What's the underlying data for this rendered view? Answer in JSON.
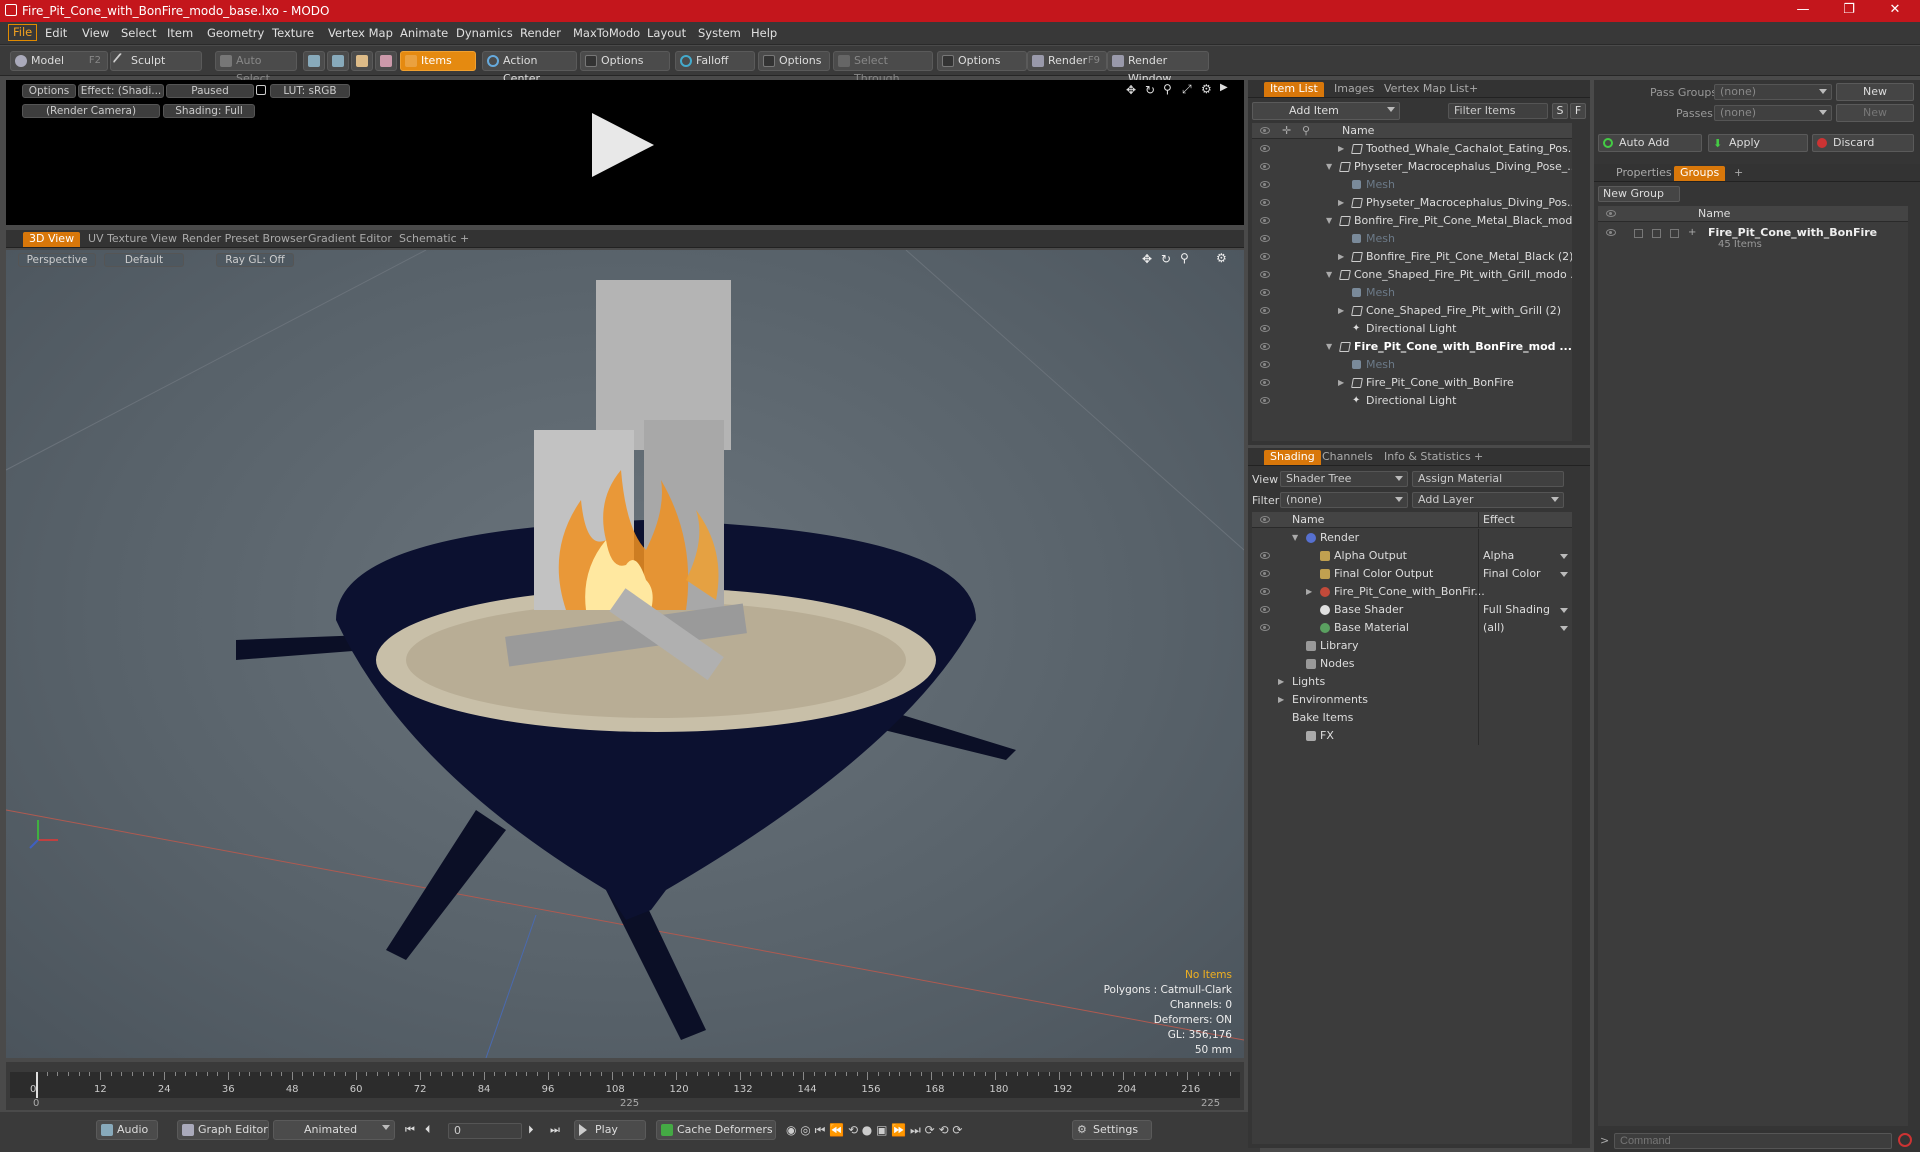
{
  "window": {
    "title": "Fire_Pit_Cone_with_BonFire_modo_base.lxo - MODO",
    "minimize": "—",
    "maximize": "❐",
    "close": "✕"
  },
  "menu": [
    "File",
    "Edit",
    "View",
    "Select",
    "Item",
    "Geometry",
    "Texture",
    "Vertex Map",
    "Animate",
    "Dynamics",
    "Render",
    "MaxToModo",
    "Layout",
    "System",
    "Help"
  ],
  "toolbar": {
    "model": "Model",
    "model_key": "F2",
    "sculpt": "Sculpt",
    "auto_select": "Auto Select",
    "items": "Items",
    "action_center": "Action Center",
    "options1": "Options",
    "falloff": "Falloff",
    "options2": "Options",
    "select_through": "Select Through",
    "options3": "Options",
    "render": "Render",
    "render_key": "F9",
    "render_window": "Render Window"
  },
  "preview": {
    "options": "Options",
    "effect": "Effect: (Shadi...",
    "paused": "Paused",
    "lut": "LUT: sRGB",
    "camera": "(Render Camera)",
    "shading": "Shading: Full"
  },
  "viewport_tabs": [
    "3D View",
    "UV Texture View",
    "Render Preset Browser",
    "Gradient Editor",
    "Schematic",
    "+"
  ],
  "viewport": {
    "perspective": "Perspective",
    "default": "Default",
    "raygl": "Ray GL: Off",
    "info": [
      "No Items",
      "Polygons : Catmull-Clark",
      "Channels: 0",
      "Deformers: ON",
      "GL: 356,176",
      "50 mm"
    ]
  },
  "timeline": {
    "ticks": [
      "0",
      "12",
      "24",
      "36",
      "48",
      "60",
      "72",
      "84",
      "96",
      "108",
      "120",
      "132",
      "144",
      "156",
      "168",
      "180",
      "192",
      "204",
      "216"
    ],
    "range_start": "0",
    "range_mid": "225",
    "range_end": "225"
  },
  "bottombar": {
    "audio": "Audio",
    "graph_editor": "Graph Editor",
    "animated": "Animated",
    "frame": "0",
    "play": "Play",
    "cache_deformers": "Cache Deformers",
    "settings": "Settings"
  },
  "item_list": {
    "tabs": [
      "Item List",
      "Images",
      "Vertex Map List",
      "+"
    ],
    "add_item": "Add Item",
    "filter_items": "Filter Items",
    "s": "S",
    "f": "F",
    "header_name": "Name",
    "rows": [
      {
        "label": "Toothed_Whale_Cachalot_Eating_Pos...",
        "type": "item",
        "indent": 3,
        "bold": false,
        "arrow": true,
        "dim": false
      },
      {
        "label": "Physeter_Macrocephalus_Diving_Pose_...",
        "type": "scene",
        "indent": 2,
        "bold": false,
        "arrow": true,
        "dim": false
      },
      {
        "label": "Mesh",
        "type": "mesh",
        "indent": 3,
        "bold": false,
        "arrow": false,
        "dim": true
      },
      {
        "label": "Physeter_Macrocephalus_Diving_Pos...",
        "type": "item",
        "indent": 3,
        "bold": false,
        "arrow": true,
        "dim": false
      },
      {
        "label": "Bonfire_Fire_Pit_Cone_Metal_Black_mod...",
        "type": "scene",
        "indent": 2,
        "bold": false,
        "arrow": true,
        "dim": false
      },
      {
        "label": "Mesh",
        "type": "mesh",
        "indent": 3,
        "bold": false,
        "arrow": false,
        "dim": true
      },
      {
        "label": "Bonfire_Fire_Pit_Cone_Metal_Black (2)",
        "type": "item",
        "indent": 3,
        "bold": false,
        "arrow": true,
        "dim": false
      },
      {
        "label": "Cone_Shaped_Fire_Pit_with_Grill_modo ...",
        "type": "scene",
        "indent": 2,
        "bold": false,
        "arrow": true,
        "dim": false
      },
      {
        "label": "Mesh",
        "type": "mesh",
        "indent": 3,
        "bold": false,
        "arrow": false,
        "dim": true
      },
      {
        "label": "Cone_Shaped_Fire_Pit_with_Grill (2)",
        "type": "item",
        "indent": 3,
        "bold": false,
        "arrow": true,
        "dim": false
      },
      {
        "label": "Directional Light",
        "type": "light",
        "indent": 3,
        "bold": false,
        "arrow": false,
        "dim": false
      },
      {
        "label": "Fire_Pit_Cone_with_BonFire_mod ...",
        "type": "scene",
        "indent": 2,
        "bold": true,
        "arrow": true,
        "dim": false
      },
      {
        "label": "Mesh",
        "type": "mesh",
        "indent": 3,
        "bold": false,
        "arrow": false,
        "dim": true
      },
      {
        "label": "Fire_Pit_Cone_with_BonFire",
        "type": "item",
        "indent": 3,
        "bold": false,
        "arrow": true,
        "dim": false
      },
      {
        "label": "Directional Light",
        "type": "light",
        "indent": 3,
        "bold": false,
        "arrow": false,
        "dim": false
      }
    ]
  },
  "shading": {
    "tabs": [
      "Shading",
      "Channels",
      "Info & Statistics",
      "+"
    ],
    "view_label": "View",
    "view_value": "Shader Tree",
    "assign_material": "Assign Material",
    "filter_label": "Filter",
    "filter_value": "(none)",
    "add_layer": "Add Layer",
    "header_name": "Name",
    "header_effect": "Effect",
    "rows": [
      {
        "label": "Render",
        "effect": "",
        "indent": 1,
        "eye": false,
        "icon": "sphere-blue"
      },
      {
        "label": "Alpha Output",
        "effect": "Alpha",
        "indent": 2,
        "eye": true,
        "icon": "output"
      },
      {
        "label": "Final Color Output",
        "effect": "Final Color",
        "indent": 2,
        "eye": true,
        "icon": "output"
      },
      {
        "label": "Fire_Pit_Cone_with_BonFir...",
        "effect": "",
        "indent": 2,
        "eye": true,
        "icon": "material-red"
      },
      {
        "label": "Base Shader",
        "effect": "Full Shading",
        "indent": 2,
        "eye": true,
        "icon": "sphere-white"
      },
      {
        "label": "Base Material",
        "effect": "(all)",
        "indent": 2,
        "eye": true,
        "icon": "sphere-green"
      },
      {
        "label": "Library",
        "effect": "",
        "indent": 1,
        "eye": false,
        "icon": "folder"
      },
      {
        "label": "Nodes",
        "effect": "",
        "indent": 1,
        "eye": false,
        "icon": "folder"
      },
      {
        "label": "Lights",
        "effect": "",
        "indent": 0,
        "eye": false,
        "icon": "none"
      },
      {
        "label": "Environments",
        "effect": "",
        "indent": 0,
        "eye": false,
        "icon": "none"
      },
      {
        "label": "Bake Items",
        "effect": "",
        "indent": 0,
        "eye": false,
        "icon": "none"
      },
      {
        "label": "FX",
        "effect": "",
        "indent": 1,
        "eye": false,
        "icon": "fx"
      }
    ]
  },
  "right_panel": {
    "pass_groups_label": "Pass Groups",
    "pass_groups_value": "(none)",
    "new1": "New",
    "passes_label": "Passes",
    "passes_value": "(none)",
    "new2": "New",
    "auto_add": "Auto Add",
    "apply": "Apply",
    "discard": "Discard",
    "tabs": [
      "Properties",
      "Groups",
      "+"
    ],
    "new_group": "New Group",
    "header_name": "Name",
    "group_name": "Fire_Pit_Cone_with_BonFire",
    "group_count": "45 Items",
    "command_placeholder": "Command"
  },
  "colors": {
    "accent": "#e58a10",
    "title_bar": "#c4161c",
    "viewport_bg": "#5b6670"
  }
}
